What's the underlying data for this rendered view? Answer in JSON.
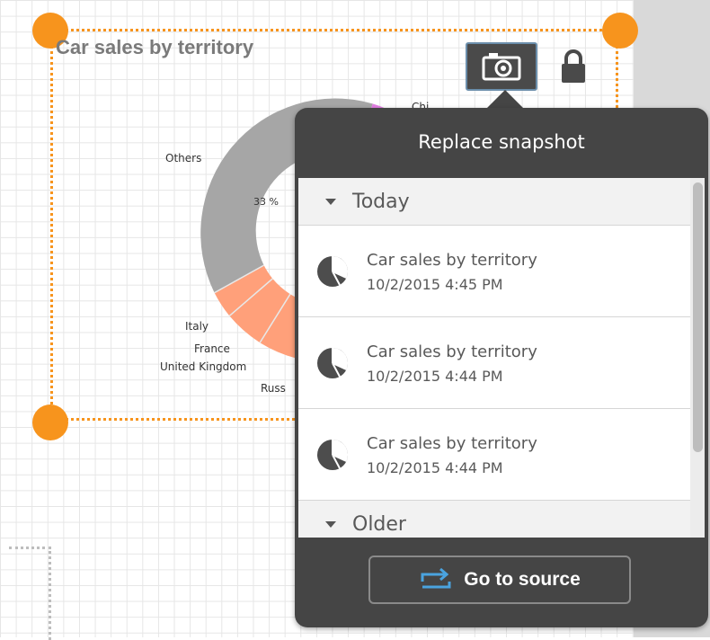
{
  "sheet": {
    "chart_title": "Car sales by territory",
    "chart_labels": {
      "others": "Others",
      "percent": "33 %",
      "italy": "Italy",
      "france": "France",
      "uk": "United Kingdom",
      "russia": "Russ",
      "china": "Chi"
    }
  },
  "toolbar": {
    "snapshot_icon": "camera-icon",
    "lock_icon": "lock-icon"
  },
  "colors": {
    "accent_orange": "#f7941d",
    "popover_bg": "#454545",
    "donut_gray": "#a6a6a6",
    "donut_salmon": "#ffa07a",
    "donut_pink": "#e37fe3",
    "goto_icon": "#4aa3df"
  },
  "popover": {
    "title": "Replace snapshot",
    "groups": [
      {
        "label": "Today",
        "items": [
          {
            "title": "Car sales by territory",
            "date": "10/2/2015 4:45 PM",
            "icon": "snapshot-pie-icon"
          },
          {
            "title": "Car sales by territory",
            "date": "10/2/2015 4:44 PM",
            "icon": "snapshot-pie-icon"
          },
          {
            "title": "Car sales by territory",
            "date": "10/2/2015 4:44 PM",
            "icon": "snapshot-pie-icon"
          }
        ]
      },
      {
        "label": "Older",
        "items": []
      }
    ],
    "go_to_source_label": "Go to source",
    "go_to_source_icon": "go-to-source-arrow-icon"
  }
}
